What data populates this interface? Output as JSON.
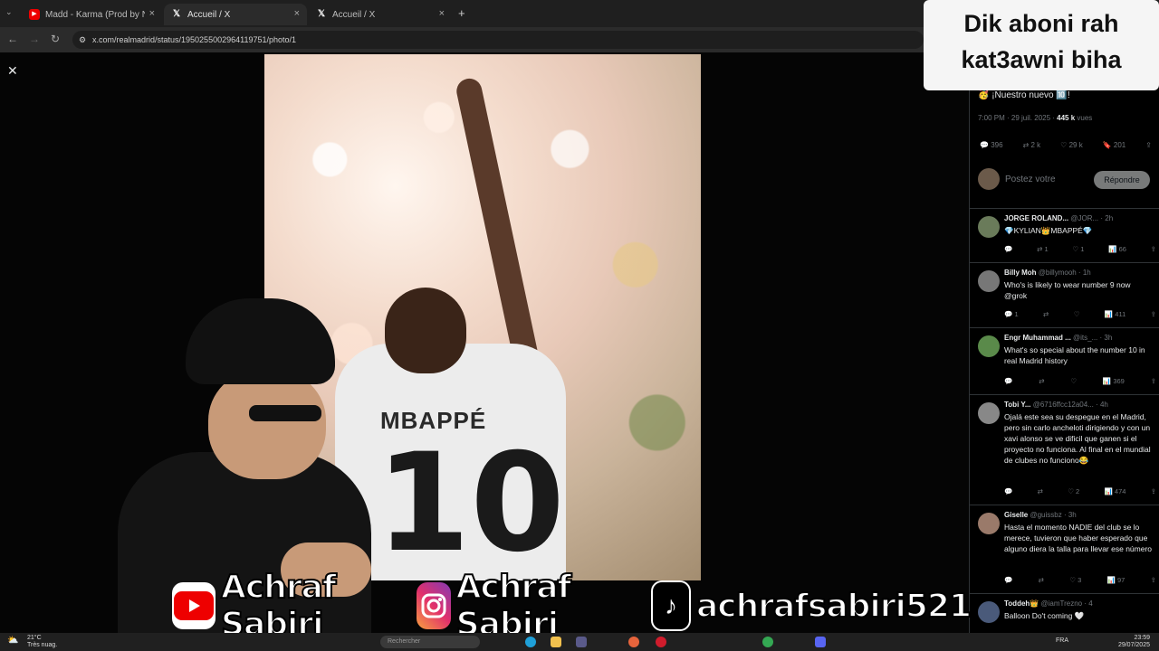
{
  "browser": {
    "tabs": [
      {
        "label": "Madd - Karma (Prod by NOUVI",
        "icon": "youtube-icon"
      },
      {
        "label": "Accueil / X",
        "icon": "x-logo-icon"
      },
      {
        "label": "Accueil / X",
        "icon": "x-logo-icon"
      }
    ],
    "new_tab": "+",
    "url": "x.com/realmadrid/status/1950255002964119751/photo/1"
  },
  "overlay_text": {
    "line1": "Dik aboni rah",
    "line2": "kat3awni biha"
  },
  "post": {
    "text": "🥳 ¡Nuestro nuevo 🔟!",
    "time": "7:00 PM · 29 juil. 2025 · ",
    "views_count": "445 k",
    "views_label": " vues",
    "replies": "396",
    "reposts": "2 k",
    "likes": "29 k",
    "bookmarks": "201",
    "reply_placeholder": "Postez votre ",
    "reply_button": "Répondre"
  },
  "comments": [
    {
      "name": "JORGE ROLAND...",
      "handle": "@JOR... · 2h",
      "text": "💎KYLIAN👑MBAPPÉ💎",
      "replies": "",
      "reposts": "1",
      "likes": "1",
      "views": "66"
    },
    {
      "name": "Billy Moh",
      "handle": "@billymooh · 1h",
      "text": "Who's is likely to wear number 9 now @grok",
      "replies": "1",
      "reposts": "",
      "likes": "",
      "views": "411"
    },
    {
      "name": "Engr Muhammad ...",
      "handle": "@its_... · 3h",
      "text": "What's so special about the number 10 in real Madrid history",
      "replies": "",
      "reposts": "",
      "likes": "",
      "views": "369"
    },
    {
      "name": "Tobi Y...",
      "handle": "@6716ffcc12a04... · 4h",
      "text": "Ojalá este sea su despegue en el Madrid, pero sin carlo ancheloti dirigiendo y con un xavi alonso se ve dificil que ganen si el proyecto no funciona. Al final en el mundial de clubes no funciono😂",
      "replies": "",
      "reposts": "",
      "likes": "2",
      "views": "474"
    },
    {
      "name": "Giselle",
      "handle": "@guissbz · 3h",
      "text": "Hasta el momento NADIE del club se lo merece, tuvieron que haber esperado que alguno diera la talla para llevar ese número",
      "replies": "",
      "reposts": "",
      "likes": "3",
      "views": "97"
    },
    {
      "name": "Toddeh👑",
      "handle": "@iamTrezno · 4",
      "text": "Balloon Do't coming 🤍",
      "replies": "",
      "reposts": "",
      "likes": "",
      "views": ""
    }
  ],
  "photo": {
    "jersey_name": "MBAPPÉ",
    "jersey_number": "10"
  },
  "socials": [
    {
      "icon": "youtube-icon",
      "label": "Achraf Sabiri"
    },
    {
      "icon": "instagram-icon",
      "label": "Achraf Sabiri"
    },
    {
      "icon": "tiktok-icon",
      "label": "achrafsabiri521"
    }
  ],
  "taskbar": {
    "weather_temp": "21°C",
    "weather_desc": "Très nuag.",
    "search_placeholder": "Rechercher",
    "lang": "FRA",
    "time": "23:59",
    "date": "29/07/2025"
  },
  "colors": {
    "x_bg": "#000000",
    "overlay_bg": "#f5f5f5",
    "tab_bg": "#1f1f1f"
  }
}
